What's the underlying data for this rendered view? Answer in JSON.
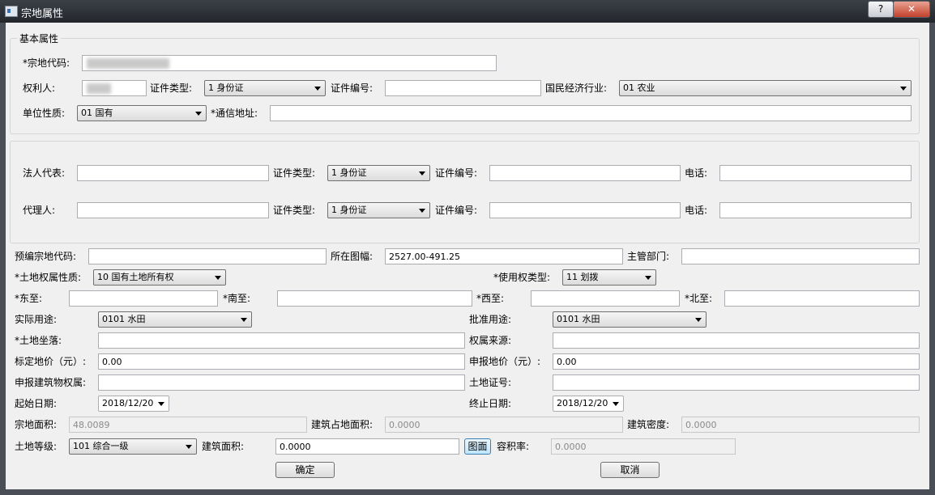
{
  "window": {
    "title": "宗地属性",
    "help_label": "?",
    "close_label": "✕"
  },
  "basic": {
    "group_title": "基本属性",
    "parcel_code_label": "*宗地代码:",
    "owner_label": "权利人:",
    "cert_type_label": "证件类型:",
    "cert_type_value": "1 身份证",
    "cert_no_label": "证件编号:",
    "industry_label": "国民经济行业:",
    "industry_value": "01 农业",
    "unit_nature_label": "单位性质:",
    "unit_nature_value": "01 国有",
    "address_label": "*通信地址:"
  },
  "legal": {
    "legal_rep_label": "法人代表:",
    "cert_type_label": "证件类型:",
    "cert_type_value": "1 身份证",
    "cert_no_label": "证件编号:",
    "phone_label": "电话:",
    "agent_label": "代理人:",
    "agent_cert_type_label": "证件类型:",
    "agent_cert_type_value": "1 身份证",
    "agent_cert_no_label": "证件编号:",
    "agent_phone_label": "电话:"
  },
  "parcel": {
    "pre_code_label": "预编宗地代码:",
    "map_sheet_label": "所在图幅:",
    "map_sheet_value": "2527.00-491.25",
    "dept_label": "主管部门:",
    "ownership_nature_label": "*土地权属性质:",
    "ownership_nature_value": "10 国有土地所有权",
    "use_right_type_label": "*使用权类型:",
    "use_right_type_value": "11 划拨",
    "east_label": "*东至:",
    "south_label": "*南至:",
    "west_label": "*西至:",
    "north_label": "*北至:",
    "actual_use_label": "实际用途:",
    "actual_use_value": "0101 水田",
    "approved_use_label": "批准用途:",
    "approved_use_value": "0101 水田",
    "location_label": "*土地坐落:",
    "rights_source_label": "权属来源:",
    "std_price_label": "标定地价（元）:",
    "std_price_value": "0.00",
    "declared_price_label": "申报地价（元）:",
    "declared_price_value": "0.00",
    "building_rights_label": "申报建筑物权属:",
    "land_cert_label": "土地证号:",
    "start_date_label": "起始日期:",
    "start_date_value": "2018/12/20",
    "end_date_label": "终止日期:",
    "end_date_value": "2018/12/20",
    "area_label": "宗地面积:",
    "area_value": "48.0089",
    "building_footprint_label": "建筑占地面积:",
    "building_footprint_value": "0.0000",
    "building_density_label": "建筑密度:",
    "building_density_value": "0.0000",
    "land_grade_label": "土地等级:",
    "land_grade_value": "101 综合一级",
    "building_area_label": "建筑面积:",
    "building_area_value": "0.0000",
    "map_area_button": "图面",
    "plot_ratio_label": "容积率:",
    "plot_ratio_value": "0.0000"
  },
  "actions": {
    "ok_label": "确定",
    "cancel_label": "取消"
  }
}
